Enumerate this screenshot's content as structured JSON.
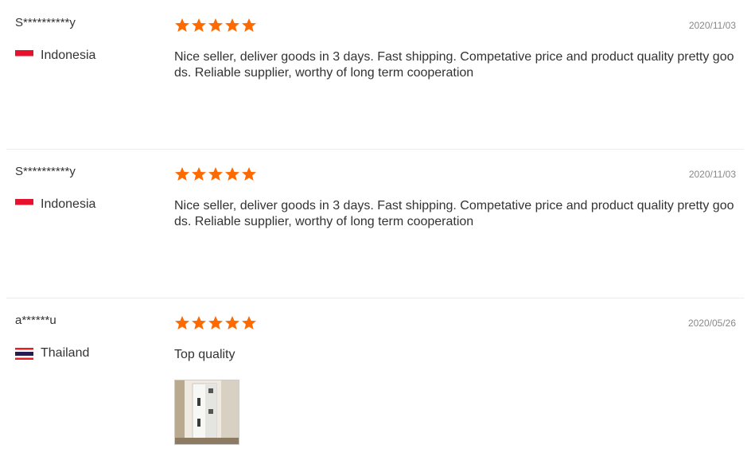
{
  "reviews": [
    {
      "buyer": "S**********y",
      "country": "Indonesia",
      "rating": 5,
      "date": "2020/11/03",
      "content": "Nice seller, deliver goods in 3 days. Fast shipping. Competative price and product quality pretty goods. Reliable supplier, worthy of long term cooperation"
    },
    {
      "buyer": "S**********y",
      "country": "Indonesia",
      "rating": 5,
      "date": "2020/11/03",
      "content": "Nice seller, deliver goods in 3 days. Fast shipping. Competative price and product quality pretty goods. Reliable supplier, worthy of long term cooperation"
    },
    {
      "buyer": "a******u",
      "country": "Thailand",
      "rating": 5,
      "date": "2020/05/26",
      "content": "Top quality",
      "photos": [
        "product-photo"
      ]
    }
  ],
  "colors": {
    "star": "#ff6a00",
    "date": "#888888",
    "divider": "#ececec"
  }
}
